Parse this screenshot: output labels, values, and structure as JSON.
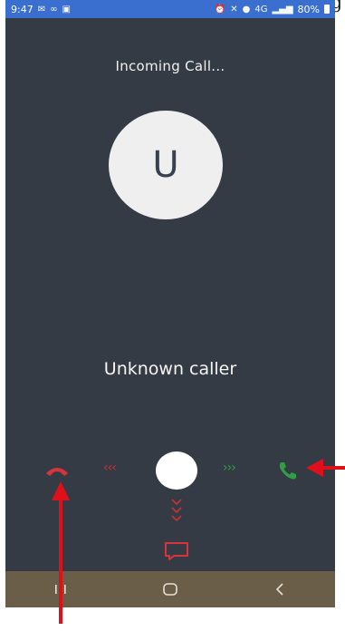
{
  "status_bar": {
    "time": "9:47",
    "left_icons": [
      "messenger-icon",
      "voicemail-icon",
      "image-icon"
    ],
    "right_icons": [
      "alarm-icon",
      "mute-icon",
      "location-icon",
      "signal-icon"
    ],
    "network": "4G",
    "battery": "80%"
  },
  "call": {
    "status_label": "Incoming Call...",
    "avatar_initial": "U",
    "caller_name": "Unknown caller"
  },
  "controls": {
    "decline_icon": "hang-up-icon",
    "answer_icon": "phone-icon",
    "left_chevrons": "‹‹‹",
    "right_chevrons": "›››",
    "message_icon": "message-icon"
  },
  "colors": {
    "background": "#353b45",
    "status_bar": "#3a6fd0",
    "decline": "#d9343c",
    "answer": "#2f9e44",
    "nav_bar": "#6b5e48",
    "annotation_arrow": "#e0101a"
  },
  "corner_glyph": "g"
}
